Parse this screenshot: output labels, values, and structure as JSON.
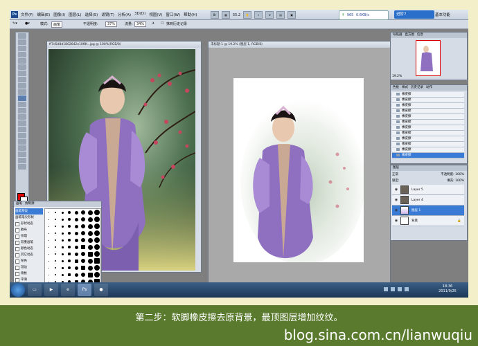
{
  "app": {
    "menu": [
      "文件(F)",
      "编辑(E)",
      "图像(I)",
      "图层(L)",
      "选择(S)",
      "滤镜(T)",
      "分析(A)",
      "3D(D)",
      "视图(V)",
      "窗口(W)",
      "帮助(H)"
    ],
    "zoom_menu": "55.2",
    "bridge_value": "965",
    "bridge_speed": "0.6KB/s",
    "promo_label": "进阶7",
    "workspace_label": "基本功能"
  },
  "options": {
    "mode_label": "模式:",
    "mode_value": "画笔",
    "opacity_label": "不透明度:",
    "opacity_value": "37%",
    "flow_label": "流量:",
    "flow_value": "34%",
    "erase_history": "抹到历史记录"
  },
  "doc1": {
    "title": "ff7d5d8d1802642e10f8f...jpg @ 100%(RGB/8)"
  },
  "doc2": {
    "title": "未标题-1 @ 19.2% (图层 1, RGB/8)"
  },
  "brush_panel": {
    "tabs": [
      "画笔",
      "仿制源"
    ],
    "items": [
      "画笔预设",
      "画笔笔尖形状",
      "形状动态",
      "散布",
      "纹理",
      "双重画笔",
      "颜色动态",
      "其它动态",
      "杂色",
      "湿边",
      "喷枪",
      "平滑",
      "保护纹理"
    ]
  },
  "navigator": {
    "tabs": [
      "导航器",
      "直方图",
      "信息"
    ],
    "zoom": "19.2%"
  },
  "history": {
    "tabs": [
      "色板",
      "样式",
      "历史记录",
      "动作"
    ],
    "items": [
      "橡皮擦",
      "橡皮擦",
      "橡皮擦",
      "橡皮擦",
      "橡皮擦",
      "橡皮擦",
      "橡皮擦",
      "橡皮擦",
      "橡皮擦",
      "橡皮擦",
      "橡皮擦",
      "橡皮擦"
    ]
  },
  "layers": {
    "tabs": [
      "图层"
    ],
    "blend_mode": "正常",
    "opacity_label": "不透明度:",
    "opacity_value": "100%",
    "lock_label": "锁定:",
    "fill_label": "填充:",
    "fill_value": "100%",
    "items": [
      {
        "name": "Layer 5",
        "thumb": "dark"
      },
      {
        "name": "Layer 4",
        "thumb": "dark"
      },
      {
        "name": "图层 1",
        "thumb": "girl"
      },
      {
        "name": "背景",
        "thumb": "white"
      }
    ]
  },
  "taskbar": {
    "time": "18:36",
    "date": "2011/9/25"
  },
  "caption": "第二步：软脚橡皮擦去原背景，最顶图层增加纹纹。",
  "credit": "blog.sina.com.cn/lianwuqiu",
  "colors": {
    "foreground": "#e00000",
    "background": "#ffffff",
    "selection": "#3a7bd5",
    "caption_bar": "#5a7a2e"
  }
}
